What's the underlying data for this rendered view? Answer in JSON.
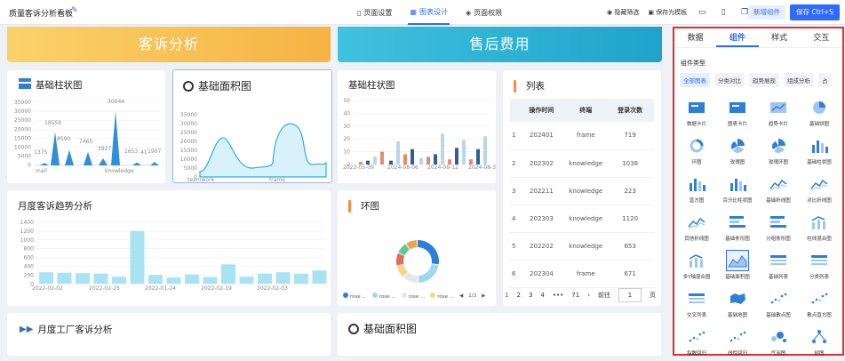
{
  "header": {
    "title": "质量客诉分析看板",
    "tabs": [
      {
        "label": "页面设置",
        "icon": "bookmark-icon"
      },
      {
        "label": "图表设计",
        "icon": "chart-design-icon",
        "active": true
      },
      {
        "label": "页面权限",
        "icon": "shield-icon"
      }
    ],
    "hide_filter": "隐藏筛选",
    "save_template": "保存为模板",
    "add_component": "新增组件",
    "save": "保存 Ctrl+S"
  },
  "banners": {
    "left": "客诉分析",
    "right": "售后费用"
  },
  "cards": {
    "basic_bar": "基础柱状图",
    "basic_area": "基础面积图",
    "basic_bar2": "基础柱状图",
    "list": "列表",
    "monthly_trend": "月度客诉趋势分析",
    "ring": "环图",
    "factory": "月度工厂客诉分析",
    "basic_area2": "基础面积图"
  },
  "bar_chart": {
    "ticks": [
      "35000",
      "30000",
      "25000",
      "20000",
      "15000",
      "10000",
      "5000",
      "0"
    ],
    "labels": [
      "1375",
      "18559",
      "8590",
      "7465",
      "3927",
      "30044",
      "1653",
      "41",
      "1907"
    ],
    "x": [
      "mail",
      "knowledge"
    ]
  },
  "area_chart": {
    "ticks": [
      "35000",
      "30000",
      "25000",
      "20000",
      "15000",
      "10000",
      "5000",
      "0"
    ],
    "x": [
      "teamwork",
      "frame"
    ]
  },
  "bar2_chart": {
    "ticks": [
      "50",
      "40",
      "30",
      "20",
      "10",
      "0"
    ],
    "x": [
      "2023-05-09",
      "2024-08-06",
      "2024-08-12",
      "2024-08-30"
    ]
  },
  "trend_chart": {
    "ticks": [
      "1400",
      "1200",
      "1000",
      "800",
      "600",
      "400",
      "200",
      "0"
    ],
    "x": [
      "2022-02-02",
      "2022-02-25",
      "2022-01-24",
      "2022-02-19",
      "2022-02-03"
    ]
  },
  "ring_legend": [
    "rose ...",
    "rose ...",
    "rose ...",
    "rose ..."
  ],
  "ring_pager": "1/3",
  "list_table": {
    "headers": [
      "",
      "操作时间",
      "终端",
      "登录次数"
    ],
    "rows": [
      [
        "1",
        "202401",
        "frame",
        "719"
      ],
      [
        "2",
        "202302",
        "knowledge",
        "1038"
      ],
      [
        "3",
        "202211",
        "knowledge",
        "223"
      ],
      [
        "4",
        "202303",
        "knowledge",
        "1120"
      ],
      [
        "5",
        "202202",
        "knowledge",
        "653"
      ],
      [
        "6",
        "202304",
        "frame",
        "671"
      ]
    ],
    "pager": {
      "pages": [
        "1",
        "2",
        "3",
        "4",
        "•••",
        "71"
      ],
      "goto": "前往",
      "page_value": "1",
      "page_unit": "页"
    }
  },
  "panel": {
    "tabs": [
      "数据",
      "组件",
      "样式",
      "交互"
    ],
    "type_title": "组件类型",
    "chips": [
      "全部图表",
      "分类对比",
      "趋势展现",
      "组成分析",
      "占"
    ],
    "items": [
      "数据卡片",
      "图表卡片",
      "趋势卡片",
      "基础饼图",
      "环图",
      "玫瑰图",
      "玫瑰环图",
      "基础柱状图",
      "直方图",
      "百分比柱状图",
      "基础折线图",
      "对比折线图",
      "其他折线图",
      "基础条形图",
      "分组条形图",
      "柱线混合图",
      "多Y轴混合图",
      "基础面积图",
      "基础列表",
      "分类列表",
      "交叉列表",
      "基础地图",
      "基础散点图",
      "散点直方图",
      "指数回归",
      "线性回归",
      "气泡图",
      "树图"
    ]
  }
}
